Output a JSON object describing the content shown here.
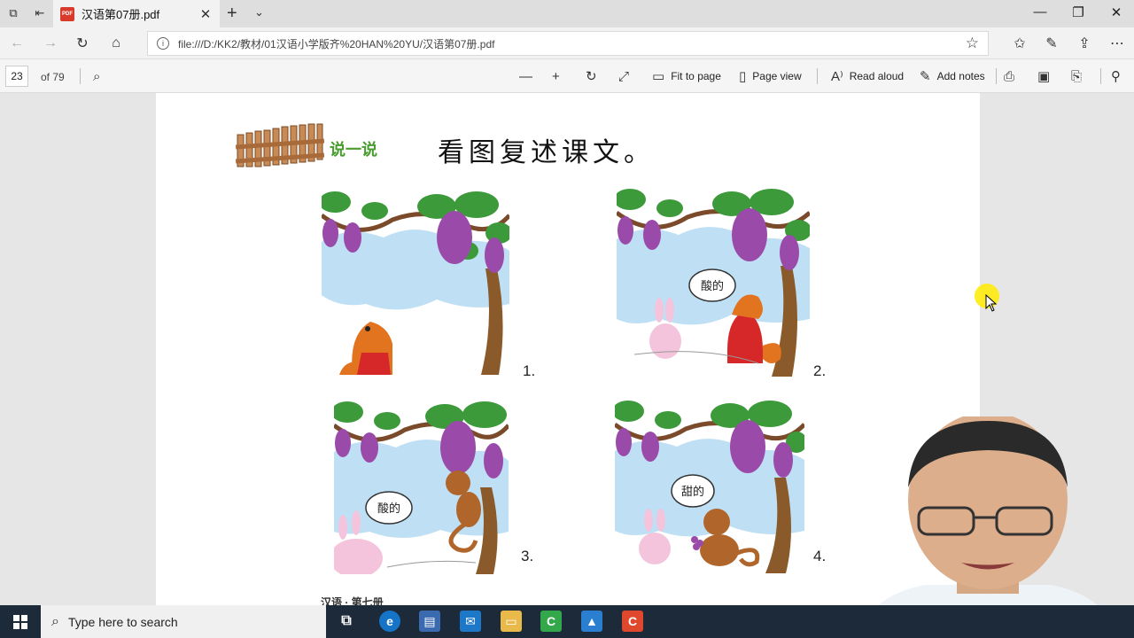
{
  "browser": {
    "tab_title": "汉语第07册.pdf",
    "tab_badge": "PDF",
    "url": "file:///D:/KK2/教材/01汉语小学版齐%20HAN%20YU/汉语第07册.pdf"
  },
  "pdf_toolbar": {
    "page_number": "23",
    "page_count": "of 79",
    "fit_to_page": "Fit to page",
    "page_view": "Page view",
    "read_aloud": "Read aloud",
    "add_notes": "Add notes"
  },
  "document": {
    "section_tag": "说一说",
    "heading": "看图复述课文。",
    "panels": [
      {
        "number": "1.",
        "bubble": ""
      },
      {
        "number": "2.",
        "bubble": "酸的"
      },
      {
        "number": "3.",
        "bubble": "酸的"
      },
      {
        "number": "4.",
        "bubble": "甜的"
      }
    ],
    "footer": "汉语 · 第七册"
  },
  "taskbar": {
    "search_placeholder": "Type here to search"
  },
  "colors": {
    "sky": "#bfe0f4",
    "leaf": "#3c9a3a",
    "grape": "#9a4aa8",
    "trunk": "#8a5a2a",
    "fox": "#e2731f",
    "rabbit": "#f3c4dc",
    "monkey": "#b0652a",
    "taskbar": "#1d2a3a"
  }
}
